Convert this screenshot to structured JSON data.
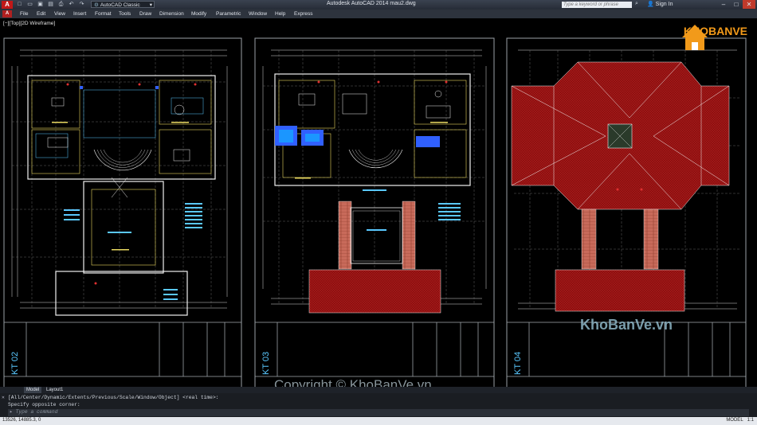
{
  "app": {
    "title": "Autodesk AutoCAD 2014    mau2.dwg",
    "workspace": "AutoCAD Classic",
    "search_placeholder": "Type a keyword or phrase",
    "sign_in": "Sign In"
  },
  "menu": [
    "File",
    "Edit",
    "View",
    "Insert",
    "Format",
    "Tools",
    "Draw",
    "Dimension",
    "Modify",
    "Parametric",
    "Window",
    "Help",
    "Express"
  ],
  "viewport_label": "[−][Top][2D Wireframe]",
  "sheets": [
    {
      "id": "KT 02"
    },
    {
      "id": "KT 03"
    },
    {
      "id": "KT 04"
    }
  ],
  "watermark": "KhoBanVe.vn",
  "logo_text": "KHOBANVE",
  "copyright": "Copyright © KhoBanVe.vn",
  "tabs": [
    "Model",
    "Layout1"
  ],
  "command": {
    "line1": "[All/Center/Dynamic/Extents/Previous/Scale/Window/Object] <real time>:",
    "line2": "Specify opposite corner:",
    "prompt": "Type a command"
  },
  "status": {
    "coords": "13526, 14885.3, 0",
    "model": "MODEL",
    "scale": "1:1"
  },
  "colors": {
    "roof_red": "#8a1010",
    "column": "#c86a5a",
    "cyan": "#5ac8ff",
    "yellow": "#e8d860"
  }
}
